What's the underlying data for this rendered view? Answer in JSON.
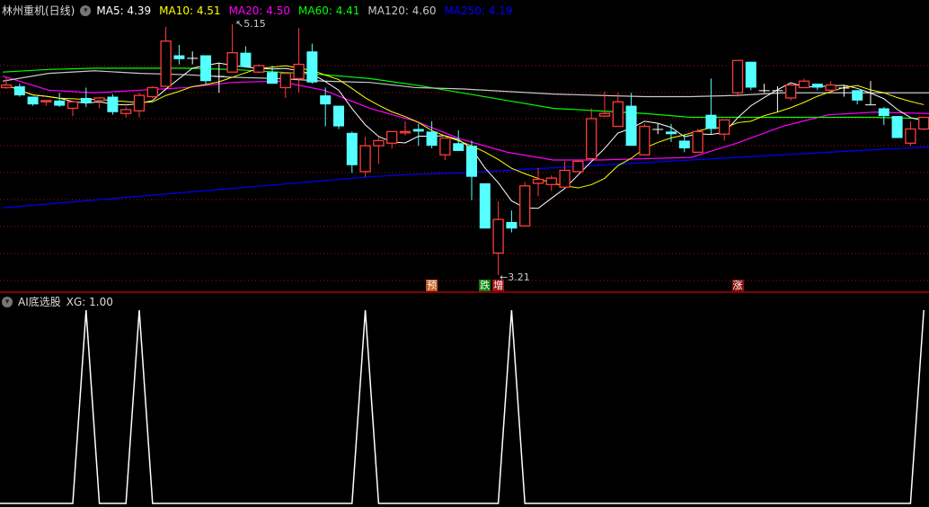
{
  "header": {
    "title": "林州重机(日线)",
    "ma": [
      {
        "label": "MA5: 4.39",
        "color": "#ffffff"
      },
      {
        "label": "MA10: 4.51",
        "color": "#ffff00"
      },
      {
        "label": "MA20: 4.50",
        "color": "#ff00ff"
      },
      {
        "label": "MA60: 4.41",
        "color": "#00ff00"
      },
      {
        "label": "MA120: 4.60",
        "color": "#c8c8c8"
      },
      {
        "label": "MA250: 4.19",
        "color": "#0000ff"
      }
    ]
  },
  "indicator": {
    "title": "AI底选股",
    "value_label": "XG: 1.00"
  },
  "price_labels": {
    "high": "5.15",
    "low": "3.21"
  },
  "markers": [
    {
      "text": "预",
      "index": 32,
      "color": "#c0561a"
    },
    {
      "text": "跌",
      "index": 36,
      "color": "#0a800a"
    },
    {
      "text": "增",
      "index": 37,
      "color": "#a01212"
    },
    {
      "text": "涨",
      "index": 55,
      "color": "#8a1010"
    }
  ],
  "colors": {
    "up": "#ff3c3c",
    "down": "#54ffff",
    "flat": "#ffffff",
    "grid": "#a01010",
    "xg": "#ffffff"
  },
  "chart_data": {
    "type": "candlestick",
    "price_range": [
      3.21,
      5.15
    ],
    "candles_ohlc": [
      [
        4.66,
        4.74,
        4.65,
        4.68
      ],
      [
        4.67,
        4.69,
        4.59,
        4.6
      ],
      [
        4.59,
        4.59,
        4.52,
        4.53
      ],
      [
        4.55,
        4.56,
        4.52,
        4.56
      ],
      [
        4.56,
        4.62,
        4.51,
        4.52
      ],
      [
        4.5,
        4.55,
        4.44,
        4.55
      ],
      [
        4.58,
        4.66,
        4.51,
        4.54
      ],
      [
        4.56,
        4.58,
        4.5,
        4.58
      ],
      [
        4.59,
        4.61,
        4.45,
        4.47
      ],
      [
        4.46,
        4.51,
        4.43,
        4.49
      ],
      [
        4.48,
        4.62,
        4.43,
        4.6
      ],
      [
        4.59,
        4.67,
        4.58,
        4.66
      ],
      [
        4.67,
        5.13,
        4.67,
        5.02
      ],
      [
        4.91,
        4.99,
        4.84,
        4.88
      ],
      [
        4.89,
        4.94,
        4.84,
        4.89
      ],
      [
        4.91,
        4.91,
        4.68,
        4.71
      ],
      [
        4.75,
        4.85,
        4.62,
        4.75
      ],
      [
        4.78,
        5.15,
        4.78,
        4.93
      ],
      [
        4.93,
        4.98,
        4.82,
        4.82
      ],
      [
        4.78,
        4.84,
        4.77,
        4.83
      ],
      [
        4.78,
        4.83,
        4.69,
        4.69
      ],
      [
        4.66,
        4.78,
        4.58,
        4.77
      ],
      [
        4.73,
        5.12,
        4.62,
        4.84
      ],
      [
        4.94,
        5.0,
        4.69,
        4.7
      ],
      [
        4.6,
        4.66,
        4.36,
        4.53
      ],
      [
        4.52,
        4.52,
        4.34,
        4.36
      ],
      [
        4.31,
        4.32,
        4.0,
        4.06
      ],
      [
        4.01,
        4.28,
        3.97,
        4.21
      ],
      [
        4.21,
        4.28,
        4.07,
        4.25
      ],
      [
        4.23,
        4.32,
        4.19,
        4.32
      ],
      [
        4.31,
        4.4,
        4.29,
        4.32
      ],
      [
        4.34,
        4.38,
        4.21,
        4.32
      ],
      [
        4.32,
        4.4,
        4.19,
        4.21
      ],
      [
        4.14,
        4.27,
        4.1,
        4.27
      ],
      [
        4.23,
        4.33,
        4.17,
        4.17
      ],
      [
        4.21,
        4.25,
        3.79,
        3.97
      ],
      [
        3.92,
        3.92,
        3.57,
        3.57
      ],
      [
        3.38,
        3.78,
        3.21,
        3.64
      ],
      [
        3.62,
        3.71,
        3.54,
        3.57
      ],
      [
        3.59,
        3.93,
        3.59,
        3.9
      ],
      [
        3.92,
        4.04,
        3.82,
        3.95
      ],
      [
        3.91,
        3.98,
        3.86,
        3.96
      ],
      [
        3.89,
        4.09,
        3.89,
        4.02
      ],
      [
        4.01,
        4.1,
        4.01,
        4.09
      ],
      [
        4.11,
        4.5,
        4.11,
        4.42
      ],
      [
        4.44,
        4.63,
        4.43,
        4.46
      ],
      [
        4.36,
        4.62,
        4.36,
        4.55
      ],
      [
        4.52,
        4.62,
        4.21,
        4.21
      ],
      [
        4.14,
        4.38,
        4.14,
        4.36
      ],
      [
        4.34,
        4.38,
        4.3,
        4.34
      ],
      [
        4.32,
        4.38,
        4.24,
        4.3
      ],
      [
        4.25,
        4.3,
        4.16,
        4.19
      ],
      [
        4.16,
        4.34,
        4.16,
        4.32
      ],
      [
        4.45,
        4.73,
        4.3,
        4.34
      ],
      [
        4.3,
        4.41,
        4.25,
        4.41
      ],
      [
        4.62,
        4.87,
        4.59,
        4.87
      ],
      [
        4.86,
        4.86,
        4.64,
        4.66
      ],
      [
        4.64,
        4.69,
        4.62,
        4.64
      ],
      [
        4.64,
        4.67,
        4.47,
        4.64
      ],
      [
        4.58,
        4.69,
        4.56,
        4.68
      ],
      [
        4.66,
        4.73,
        4.66,
        4.71
      ],
      [
        4.69,
        4.69,
        4.64,
        4.66
      ],
      [
        4.64,
        4.71,
        4.64,
        4.68
      ],
      [
        4.66,
        4.68,
        4.59,
        4.66
      ],
      [
        4.64,
        4.64,
        4.53,
        4.56
      ],
      [
        4.53,
        4.71,
        4.53,
        4.53
      ],
      [
        4.5,
        4.51,
        4.37,
        4.44
      ],
      [
        4.44,
        4.44,
        4.27,
        4.27
      ],
      [
        4.23,
        4.4,
        4.21,
        4.34
      ],
      [
        4.34,
        4.43,
        4.33,
        4.43
      ]
    ],
    "ma_series_sampled": [
      {
        "name": "MA20",
        "color": "#ff00ff",
        "values": [
          4.75,
          4.64,
          4.62,
          4.64,
          4.66,
          4.7,
          4.71,
          4.64,
          4.5,
          4.4,
          4.26,
          4.16,
          4.1,
          4.1,
          4.11,
          4.12,
          4.23,
          4.36,
          4.45,
          4.47,
          4.46
        ]
      },
      {
        "name": "MA60",
        "color": "#00ff00",
        "values": [
          4.78,
          4.8,
          4.81,
          4.81,
          4.81,
          4.8,
          4.78,
          4.76,
          4.73,
          4.68,
          4.62,
          4.56,
          4.5,
          4.48,
          4.46,
          4.43,
          4.43,
          4.43,
          4.43,
          4.43,
          4.42
        ]
      },
      {
        "name": "MA120",
        "color": "#c8c8c8",
        "values": [
          4.71,
          4.77,
          4.79,
          4.77,
          4.76,
          4.74,
          4.73,
          4.71,
          4.7,
          4.66,
          4.65,
          4.63,
          4.61,
          4.6,
          4.59,
          4.59,
          4.6,
          4.62,
          4.62,
          4.62,
          4.62
        ]
      },
      {
        "name": "MA250",
        "color": "#0000ff",
        "values": [
          3.73,
          3.76,
          3.79,
          3.82,
          3.85,
          3.88,
          3.91,
          3.94,
          3.97,
          3.99,
          4.0,
          4.02,
          4.04,
          4.06,
          4.08,
          4.1,
          4.12,
          4.14,
          4.16,
          4.18,
          4.2
        ]
      }
    ],
    "xg_signal_indices": [
      6,
      10,
      27,
      38,
      69
    ],
    "xg_range": [
      0,
      1
    ]
  }
}
